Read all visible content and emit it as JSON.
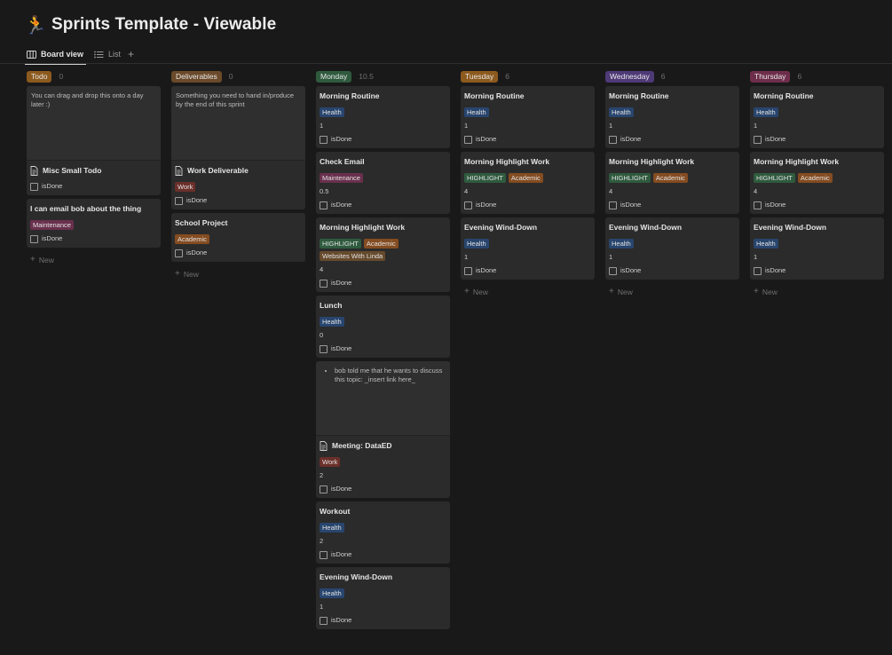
{
  "page": {
    "emoji": "🏃",
    "title": "Sprints Template - Viewable"
  },
  "tabs": [
    {
      "label": "Board view",
      "icon": "board-icon",
      "active": true
    },
    {
      "label": "List",
      "icon": "list-icon",
      "active": false
    }
  ],
  "add_view": "+",
  "new_label": "New",
  "checkbox_label": "isDone",
  "colors": {
    "Health": "#28456e",
    "Maintenance": "#69304d",
    "Work": "#6b2f2a",
    "HIGHLIGHT": "#2f5a3e",
    "Academic": "#844c21",
    "Websites With Linda": "#664a2c"
  },
  "columns": [
    {
      "label": "Todo",
      "count": "0",
      "color": "#8d5a1e",
      "cards": [
        {
          "cover": "You can drag and drop this onto a day later :)",
          "title": "Misc Small Todo",
          "doc": true,
          "tags": [],
          "value": ""
        },
        {
          "title": "I can email bob about the thing",
          "tags": [
            "Maintenance"
          ],
          "value": ""
        }
      ]
    },
    {
      "label": "Deliverables",
      "count": "0",
      "color": "#6a4a2a",
      "cards": [
        {
          "cover": "Something you need to hand in/produce by the end of this sprint",
          "title": "Work Deliverable",
          "doc": true,
          "tags": [
            "Work"
          ],
          "value": ""
        },
        {
          "title": "School Project",
          "tags": [
            "Academic"
          ],
          "value": ""
        }
      ]
    },
    {
      "label": "Monday",
      "count": "10.5",
      "color": "#2f5a3e",
      "cards": [
        {
          "title": "Morning Routine",
          "tags": [
            "Health"
          ],
          "value": "1"
        },
        {
          "title": "Check Email",
          "tags": [
            "Maintenance"
          ],
          "value": "0.5"
        },
        {
          "title": "Morning Highlight Work",
          "tags": [
            "HIGHLIGHT",
            "Academic",
            "Websites With Linda"
          ],
          "value": "4"
        },
        {
          "title": "Lunch",
          "tags": [
            "Health"
          ],
          "value": "0"
        },
        {
          "cover_list": [
            "bob told me that he wants to discuss this topic: _insert link here_"
          ],
          "title": "Meeting: DataED",
          "doc": true,
          "tags": [
            "Work"
          ],
          "value": "2"
        },
        {
          "title": "Workout",
          "tags": [
            "Health"
          ],
          "value": "2"
        },
        {
          "title": "Evening Wind-Down",
          "tags": [
            "Health"
          ],
          "value": "1"
        }
      ]
    },
    {
      "label": "Tuesday",
      "count": "6",
      "color": "#8d5a1e",
      "cards": [
        {
          "title": "Morning Routine",
          "tags": [
            "Health"
          ],
          "value": "1"
        },
        {
          "title": "Morning Highlight Work",
          "tags": [
            "HIGHLIGHT",
            "Academic"
          ],
          "value": "4"
        },
        {
          "title": "Evening Wind-Down",
          "tags": [
            "Health"
          ],
          "value": "1"
        }
      ]
    },
    {
      "label": "Wednesday",
      "count": "6",
      "color": "#4f3a78",
      "cards": [
        {
          "title": "Morning Routine",
          "tags": [
            "Health"
          ],
          "value": "1"
        },
        {
          "title": "Morning Highlight Work",
          "tags": [
            "HIGHLIGHT",
            "Academic"
          ],
          "value": "4"
        },
        {
          "title": "Evening Wind-Down",
          "tags": [
            "Health"
          ],
          "value": "1"
        }
      ]
    },
    {
      "label": "Thursday",
      "count": "6",
      "color": "#6e2e4b",
      "cards": [
        {
          "title": "Morning Routine",
          "tags": [
            "Health"
          ],
          "value": "1"
        },
        {
          "title": "Morning Highlight Work",
          "tags": [
            "HIGHLIGHT",
            "Academic"
          ],
          "value": "4"
        },
        {
          "title": "Evening Wind-Down",
          "tags": [
            "Health"
          ],
          "value": "1"
        }
      ]
    }
  ]
}
